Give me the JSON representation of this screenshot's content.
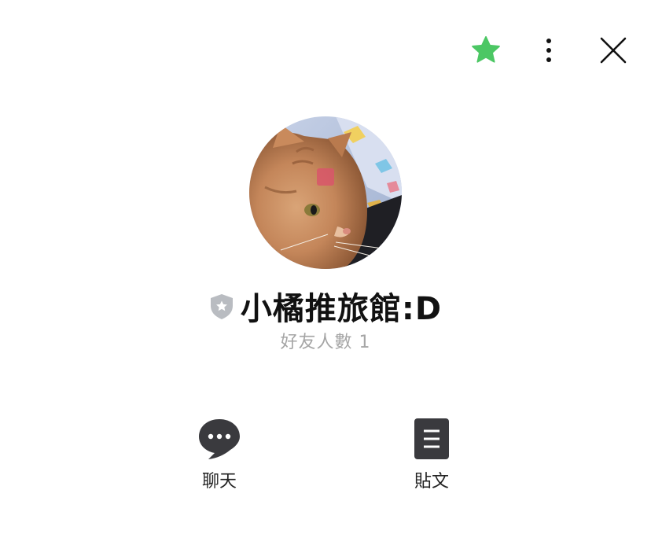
{
  "header": {
    "favorite_icon": "star-icon",
    "more_icon": "more-vertical-icon",
    "close_icon": "close-icon",
    "favorite_color": "#4cc764"
  },
  "profile": {
    "name": "小橘推旅館:D",
    "badge_icon": "shield-star-icon",
    "friends_label": "好友人數",
    "friends_count": "1",
    "avatar_description": "orange-cat-photo"
  },
  "actions": [
    {
      "label": "聊天",
      "icon": "chat-bubble-icon"
    },
    {
      "label": "貼文",
      "icon": "post-document-icon"
    }
  ],
  "colors": {
    "icon_dark": "#3a3a3e",
    "badge_gray": "#b9bcc1",
    "muted_text": "#a5a5a5"
  }
}
